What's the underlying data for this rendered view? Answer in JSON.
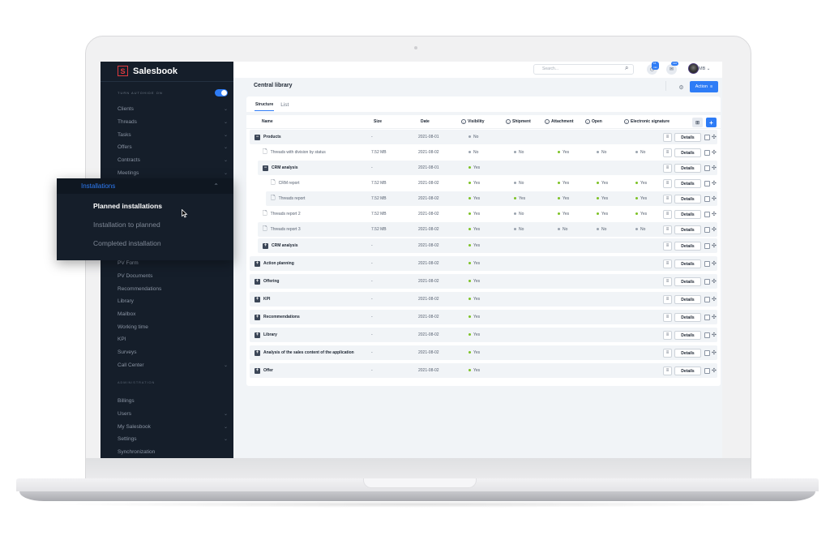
{
  "app": {
    "brand": "Salesbook",
    "logo_glyph": "S",
    "colors": {
      "accent": "#2e7cf6",
      "brand_red": "#e03a3e",
      "sidebar_bg": "#151e2a",
      "yes": "#7cc225",
      "no": "#9aa3ae"
    }
  },
  "sidebar": {
    "autohide_label": "TURN AUTOHIDE ON",
    "autohide_on": true,
    "items": [
      {
        "label": "Clients",
        "chevron": "⌄"
      },
      {
        "label": "Threads",
        "chevron": "⌄"
      },
      {
        "label": "Tasks",
        "chevron": "⌄"
      },
      {
        "label": "Offers",
        "chevron": "⌄"
      },
      {
        "label": "Contracts",
        "chevron": "⌄"
      },
      {
        "label": "Meetings",
        "chevron": "⌄"
      }
    ],
    "items_after": [
      {
        "label": "PV Form",
        "chevron": ""
      },
      {
        "label": "PV Documents",
        "chevron": ""
      },
      {
        "label": "Recommendations",
        "chevron": ""
      },
      {
        "label": "Library",
        "chevron": ""
      },
      {
        "label": "Mailbox",
        "chevron": ""
      },
      {
        "label": "Working time",
        "chevron": ""
      },
      {
        "label": "KPI",
        "chevron": ""
      },
      {
        "label": "Surveys",
        "chevron": ""
      },
      {
        "label": "Call Center",
        "chevron": "⌄"
      }
    ],
    "admin_label": "ADMINISTRATION",
    "admin_items": [
      {
        "label": "Billings",
        "chevron": ""
      },
      {
        "label": "Users",
        "chevron": "⌄"
      },
      {
        "label": "My Salesbook",
        "chevron": "⌄"
      },
      {
        "label": "Settings",
        "chevron": "⌄"
      },
      {
        "label": "Synchronization",
        "chevron": ""
      }
    ]
  },
  "popover": {
    "title": "Installations",
    "chevron": "⌃",
    "items": [
      {
        "label": "Planned installations",
        "active": true
      },
      {
        "label": "Installation to planned",
        "active": false
      },
      {
        "label": "Completed installation",
        "active": false
      }
    ]
  },
  "topbar": {
    "search_placeholder": "Search...",
    "search_icon": "⌕",
    "timer_badge": "15 min",
    "mail_badge": "122",
    "timer_icon": "◷",
    "mail_icon": "✉",
    "user_initials": "MB",
    "user_chevron": "⌄"
  },
  "page": {
    "title": "Central library",
    "settings_icon": "⚙",
    "action_label": "Action",
    "action_icon": "≡"
  },
  "tabs": [
    {
      "label": "Structure",
      "active": true
    },
    {
      "label": "List",
      "active": false
    }
  ],
  "table": {
    "columns": [
      "Name",
      "Size",
      "Date",
      "Visibility",
      "Shipment",
      "Attachment",
      "Open",
      "Electronic signature"
    ],
    "info_glyph": "i",
    "grid_icon": "⊞",
    "add_icon": "+",
    "details_label": "Details",
    "menu_glyph": "≡",
    "move_glyph": "✣",
    "file_glyph": "🗋",
    "rows": [
      {
        "name": "Products",
        "type": "folder",
        "expanded": true,
        "level": 0,
        "size": "-",
        "date": "2021-08-01",
        "visibility": "No",
        "shipment": "",
        "attachment": "",
        "open": "",
        "esign": ""
      },
      {
        "name": "Threads with division by status",
        "type": "file",
        "level": 1,
        "size": "7.52 MB",
        "date": "2021-08-02",
        "visibility": "No",
        "shipment": "No",
        "attachment": "Yes",
        "open": "No",
        "esign": "No"
      },
      {
        "name": "CRM analysis",
        "type": "folder",
        "expanded": true,
        "level": 1,
        "size": "-",
        "date": "2021-08-01",
        "visibility": "Yes",
        "shipment": "",
        "attachment": "",
        "open": "",
        "esign": ""
      },
      {
        "name": "CRM report",
        "type": "file",
        "level": 2,
        "size": "7.52 MB",
        "date": "2021-08-02",
        "visibility": "Yes",
        "shipment": "No",
        "attachment": "Yes",
        "open": "Yes",
        "esign": "Yes"
      },
      {
        "name": "Threads report",
        "type": "file",
        "level": 2,
        "size": "7.52 MB",
        "date": "2021-08-02",
        "visibility": "Yes",
        "shipment": "Yes",
        "attachment": "Yes",
        "open": "Yes",
        "esign": "Yes"
      },
      {
        "name": "Threads report 2",
        "type": "file",
        "level": 1,
        "size": "7.52 MB",
        "date": "2021-08-02",
        "visibility": "Yes",
        "shipment": "No",
        "attachment": "Yes",
        "open": "Yes",
        "esign": "Yes"
      },
      {
        "name": "Threads report 3",
        "type": "file",
        "level": 1,
        "size": "7.52 MB",
        "date": "2021-08-02",
        "visibility": "Yes",
        "shipment": "No",
        "attachment": "No",
        "open": "No",
        "esign": "No"
      },
      {
        "name": "CRM analysis",
        "type": "folder",
        "expanded": false,
        "level": 1,
        "size": "-",
        "date": "2021-08-02",
        "visibility": "Yes",
        "shipment": "",
        "attachment": "",
        "open": "",
        "esign": ""
      },
      {
        "name": "Action planning",
        "type": "folder",
        "expanded": false,
        "level": 0,
        "size": "-",
        "date": "2021-08-02",
        "visibility": "Yes",
        "shipment": "",
        "attachment": "",
        "open": "",
        "esign": ""
      },
      {
        "name": "Offering",
        "type": "folder",
        "expanded": false,
        "level": 0,
        "size": "-",
        "date": "2021-08-02",
        "visibility": "Yes",
        "shipment": "",
        "attachment": "",
        "open": "",
        "esign": ""
      },
      {
        "name": "KPI",
        "type": "folder",
        "expanded": false,
        "level": 0,
        "size": "-",
        "date": "2021-08-02",
        "visibility": "Yes",
        "shipment": "",
        "attachment": "",
        "open": "",
        "esign": ""
      },
      {
        "name": "Recommendations",
        "type": "folder",
        "expanded": false,
        "level": 0,
        "size": "-",
        "date": "2021-08-02",
        "visibility": "Yes",
        "shipment": "",
        "attachment": "",
        "open": "",
        "esign": ""
      },
      {
        "name": "Library",
        "type": "folder",
        "expanded": false,
        "level": 0,
        "size": "-",
        "date": "2021-08-02",
        "visibility": "Yes",
        "shipment": "",
        "attachment": "",
        "open": "",
        "esign": ""
      },
      {
        "name": "Analysis of the sales content of the application",
        "type": "folder",
        "expanded": false,
        "level": 0,
        "size": "-",
        "date": "2021-08-02",
        "visibility": "Yes",
        "shipment": "",
        "attachment": "",
        "open": "",
        "esign": ""
      },
      {
        "name": "Offer",
        "type": "folder",
        "expanded": false,
        "level": 0,
        "size": "-",
        "date": "2021-08-02",
        "visibility": "Yes",
        "shipment": "",
        "attachment": "",
        "open": "",
        "esign": ""
      }
    ]
  }
}
